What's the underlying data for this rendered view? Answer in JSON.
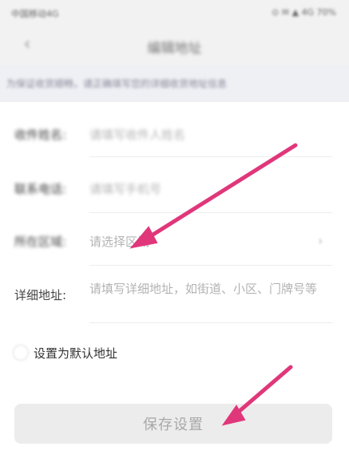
{
  "status_bar": {
    "left": "中国移动4G",
    "right": "⊙ ✉ ▲ 4G 70%"
  },
  "nav": {
    "back_icon": "chevron-left-icon",
    "title": "编辑地址"
  },
  "notice": {
    "text": "为保证收货顺畅，请正确填写您的详细收货地址信息"
  },
  "form": {
    "name": {
      "label": "收件姓名:",
      "placeholder": "请填写收件人姓名"
    },
    "phone": {
      "label": "联系电话:",
      "placeholder": "请填写手机号"
    },
    "region": {
      "label": "所在区域:",
      "placeholder": "请选择区域"
    },
    "detail": {
      "label": "详细地址:",
      "placeholder": "请填写详细地址，如街道、小区、门牌号等"
    }
  },
  "default_address": {
    "label": "设置为默认地址"
  },
  "save_button": {
    "label": "保存设置"
  },
  "colors": {
    "arrow": "#e0377b",
    "button_bg": "#ececec",
    "notice_bg": "#eef0f4"
  }
}
